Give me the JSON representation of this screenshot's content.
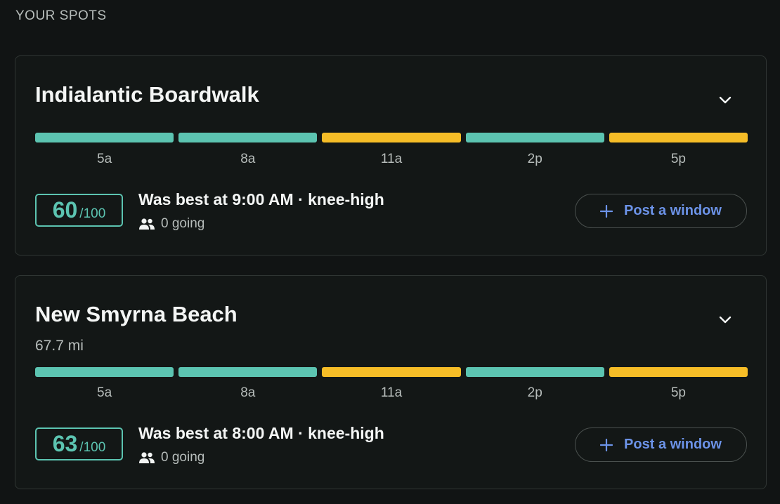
{
  "section_title": "YOUR SPOTS",
  "colors": {
    "good": "#5cc4b1",
    "fair": "#f6bd27",
    "accent": "#6c93e8"
  },
  "spots": [
    {
      "name": "Indialantic Boardwalk",
      "distance": "",
      "bars": [
        "good",
        "good",
        "fair",
        "good",
        "fair"
      ],
      "ticks": [
        "5a",
        "8a",
        "11a",
        "2p",
        "5p"
      ],
      "score": "60",
      "score_max": "/100",
      "best": "Was best at 9:00 AM · knee-high",
      "going": "0 going",
      "button_label": "Post a window",
      "chevron_icon": "chevron-down-icon"
    },
    {
      "name": "New Smyrna Beach",
      "distance": "67.7 mi",
      "bars": [
        "good",
        "good",
        "fair",
        "good",
        "fair"
      ],
      "ticks": [
        "5a",
        "8a",
        "11a",
        "2p",
        "5p"
      ],
      "score": "63",
      "score_max": "/100",
      "best": "Was best at 8:00 AM · knee-high",
      "going": "0 going",
      "button_label": "Post a window",
      "chevron_icon": "chevron-down-icon"
    }
  ]
}
